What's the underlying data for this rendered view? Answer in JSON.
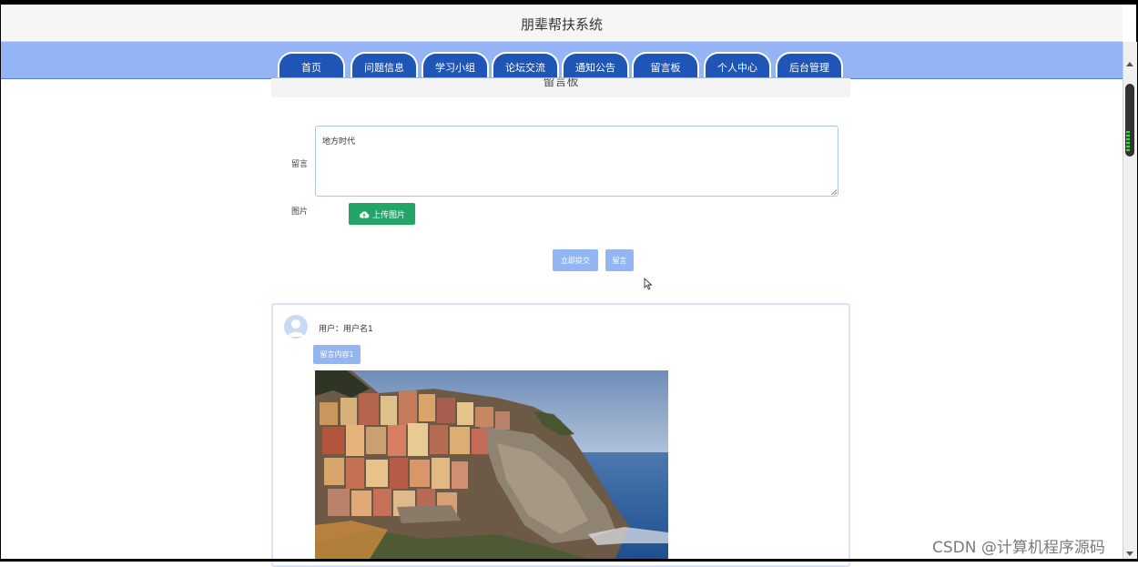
{
  "app": {
    "title": "朋辈帮扶系统"
  },
  "nav": {
    "tabs": [
      {
        "label": "首页"
      },
      {
        "label": "问题信息"
      },
      {
        "label": "学习小组"
      },
      {
        "label": "论坛交流"
      },
      {
        "label": "通知公告"
      },
      {
        "label": "留言板"
      },
      {
        "label": "个人中心"
      },
      {
        "label": "后台管理"
      }
    ]
  },
  "page": {
    "section_title": "留言板"
  },
  "form": {
    "message_label": "留言",
    "message_value": "地方时代",
    "image_label": "图片",
    "upload_button_label": "上传图片",
    "submit_button_label": "立即提交",
    "message_button_label": "留言"
  },
  "message_card": {
    "user_text": "用户：用户名1",
    "content_tag": "留言内容1"
  },
  "watermark": "CSDN @计算机程序源码",
  "colors": {
    "nav_bg": "#94b4f6",
    "tab_bg": "#1e55b6",
    "upload_green": "#22a567",
    "light_button": "#93b6f3"
  },
  "icons": {
    "upload": "cloud-upload-icon",
    "avatar": "user-avatar-icon",
    "cursor": "mouse-pointer-icon"
  }
}
